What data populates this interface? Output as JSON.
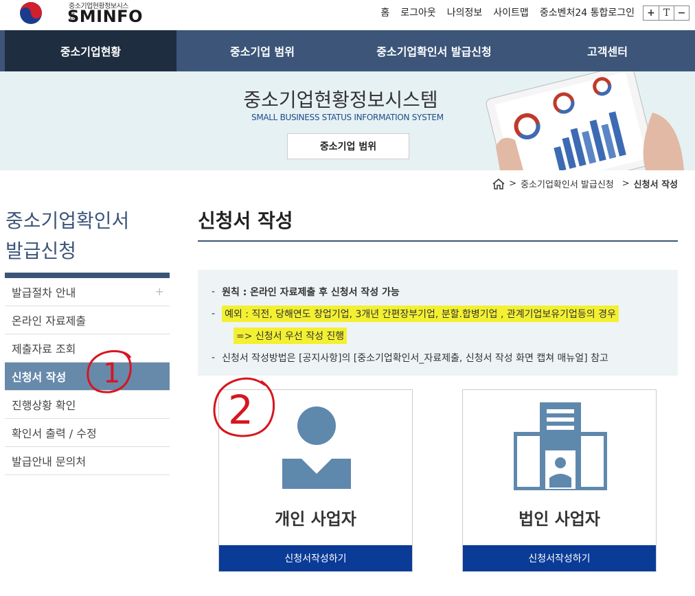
{
  "logo": {
    "subtitle": "중소기업현황정보시스템",
    "name": "SMINFO"
  },
  "top_links": [
    "홈",
    "로그아웃",
    "나의정보",
    "사이트맵",
    "중소벤처24 통합로그인"
  ],
  "font_controls": [
    "+",
    "T",
    "−"
  ],
  "nav": [
    "중소기업현황",
    "중소기업 범위",
    "중소기업확인서 발급신청",
    "고객센터"
  ],
  "banner": {
    "title": "중소기업현황정보시스템",
    "subtitle": "SMALL BUSINESS STATUS INFORMATION SYSTEM",
    "button": "중소기업 범위"
  },
  "breadcrumb": {
    "parent": "중소기업확인서 발급신청",
    "current": "신청서 작성"
  },
  "sidebar": {
    "title_line1": "중소기업확인서",
    "title_line2": "발급신청",
    "items": [
      {
        "label": "발급절차 안내",
        "plus": "+"
      },
      {
        "label": "온라인 자료제출"
      },
      {
        "label": "제출자료 조회"
      },
      {
        "label": "신청서 작성"
      },
      {
        "label": "진행상황 확인"
      },
      {
        "label": "확인서 출력 / 수정"
      },
      {
        "label": "발급안내 문의처"
      }
    ]
  },
  "main": {
    "title": "신청서 작성",
    "notice": {
      "line1": "원칙 : 온라인 자료제출 후 신청서 작성 가능",
      "line2": "예외 : 직전, 당해연도 창업기업, 3개년 간편장부기업, 분할.합병기업 , 관계기업보유기업등의 경우",
      "line3": "=> 신청서 우선 작성 진행",
      "line4": "신청서 작성방법은 [공지사항]의 [중소기업확인서_자료제출, 신청서 작성 화면 캡쳐 매뉴얼] 참고"
    },
    "cards": [
      {
        "label": "개인 사업자",
        "button": "신청서작성하기"
      },
      {
        "label": "법인 사업자",
        "button": "신청서작성하기"
      }
    ]
  },
  "annotations": [
    "1",
    "2"
  ]
}
